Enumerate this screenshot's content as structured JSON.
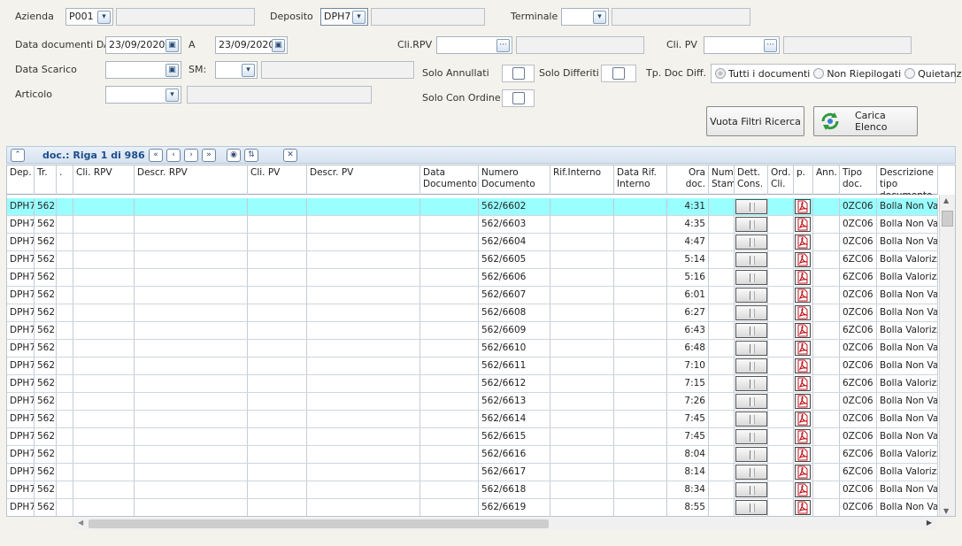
{
  "filters": {
    "azienda_label": "Azienda",
    "azienda_value": "P001",
    "deposito_label": "Deposito",
    "deposito_value": "DPH7",
    "terminale_label": "Terminale",
    "terminale_value": "",
    "data_doc_da_label": "Data documenti DA",
    "data_doc_da_value": "23/09/2020",
    "a_label": "A",
    "a_value": "23/09/2020",
    "cli_rpv_label": "Cli.RPV",
    "cli_pv_label": "Cli. PV",
    "data_scarico_label": "Data Scarico",
    "sm_label": "SM:",
    "solo_annullati_label": "Solo Annullati",
    "solo_differiti_label": "Solo Differiti",
    "tp_doc_diff_label": "Tp. Doc Diff.",
    "radio_options": [
      "Tutti i documenti",
      "Non Riepilogati",
      "Quietanze"
    ],
    "articolo_label": "Articolo",
    "solo_con_ordine_label": "Solo Con Ordine"
  },
  "buttons": {
    "vuota_filtri": "Vuota Filtri Ricerca",
    "carica_elenco": "Carica Elenco"
  },
  "grid": {
    "title": "doc.: Riga 1 di 986",
    "headers": {
      "dep": "Dep.",
      "tr": "Tr.",
      "dot": ".",
      "cli_rpv": "Cli. RPV",
      "descr_rpv": "Descr. RPV",
      "cli_pv": "Cli. PV",
      "descr_pv": "Descr. PV",
      "data_doc": "Data Documento",
      "num_doc": "Numero Documento",
      "rif_interno": "Rif.Interno",
      "data_rif": "Data Rif. Interno",
      "ora_doc": "Ora doc.",
      "num_stam": "Num Stam",
      "dett_cons": "Dett. Cons.",
      "ord_cli": "Ord. Cli.",
      "p": "p.",
      "ann": "Ann.",
      "tipo_doc": "Tipo doc.",
      "descr_tipo": "Descrizione tipo documento"
    },
    "rows": [
      {
        "dep": "DPH7",
        "tr": "562",
        "num": "562/6602",
        "ora": "4:31",
        "tipo": "0ZC06",
        "descr": "Bolla Non Valorizzata"
      },
      {
        "dep": "DPH7",
        "tr": "562",
        "num": "562/6603",
        "ora": "4:35",
        "tipo": "0ZC06",
        "descr": "Bolla Non Valorizzata"
      },
      {
        "dep": "DPH7",
        "tr": "562",
        "num": "562/6604",
        "ora": "4:47",
        "tipo": "0ZC06",
        "descr": "Bolla Non Valorizzata"
      },
      {
        "dep": "DPH7",
        "tr": "562",
        "num": "562/6605",
        "ora": "5:14",
        "tipo": "6ZC06",
        "descr": "Bolla Valorizzata"
      },
      {
        "dep": "DPH7",
        "tr": "562",
        "num": "562/6606",
        "ora": "5:16",
        "tipo": "6ZC06",
        "descr": "Bolla Valorizzata"
      },
      {
        "dep": "DPH7",
        "tr": "562",
        "num": "562/6607",
        "ora": "6:01",
        "tipo": "0ZC06",
        "descr": "Bolla Non Valorizzata"
      },
      {
        "dep": "DPH7",
        "tr": "562",
        "num": "562/6608",
        "ora": "6:27",
        "tipo": "0ZC06",
        "descr": "Bolla Non Valorizzata"
      },
      {
        "dep": "DPH7",
        "tr": "562",
        "num": "562/6609",
        "ora": "6:43",
        "tipo": "6ZC06",
        "descr": "Bolla Valorizzata"
      },
      {
        "dep": "DPH7",
        "tr": "562",
        "num": "562/6610",
        "ora": "6:48",
        "tipo": "0ZC06",
        "descr": "Bolla Non Valorizzata"
      },
      {
        "dep": "DPH7",
        "tr": "562",
        "num": "562/6611",
        "ora": "7:10",
        "tipo": "0ZC06",
        "descr": "Bolla Non Valorizzata"
      },
      {
        "dep": "DPH7",
        "tr": "562",
        "num": "562/6612",
        "ora": "7:15",
        "tipo": "6ZC06",
        "descr": "Bolla Valorizzata"
      },
      {
        "dep": "DPH7",
        "tr": "562",
        "num": "562/6613",
        "ora": "7:26",
        "tipo": "0ZC06",
        "descr": "Bolla Non Valorizzata"
      },
      {
        "dep": "DPH7",
        "tr": "562",
        "num": "562/6614",
        "ora": "7:45",
        "tipo": "0ZC06",
        "descr": "Bolla Non Valorizzata"
      },
      {
        "dep": "DPH7",
        "tr": "562",
        "num": "562/6615",
        "ora": "7:45",
        "tipo": "0ZC06",
        "descr": "Bolla Non Valorizzata"
      },
      {
        "dep": "DPH7",
        "tr": "562",
        "num": "562/6616",
        "ora": "8:04",
        "tipo": "6ZC06",
        "descr": "Bolla Valorizzata"
      },
      {
        "dep": "DPH7",
        "tr": "562",
        "num": "562/6617",
        "ora": "8:14",
        "tipo": "6ZC06",
        "descr": "Bolla Valorizzata"
      },
      {
        "dep": "DPH7",
        "tr": "562",
        "num": "562/6618",
        "ora": "8:34",
        "tipo": "0ZC06",
        "descr": "Bolla Non Valorizzata"
      },
      {
        "dep": "DPH7",
        "tr": "562",
        "num": "562/6619",
        "ora": "8:55",
        "tipo": "0ZC06",
        "descr": "Bolla Non Valorizzata"
      }
    ]
  },
  "colors": {
    "selected_row": "#99ffff",
    "toolbar_title": "#1f4d8c",
    "pdf_icon": "#c0141c"
  },
  "icons": {
    "dropdown": "chevron-down-icon",
    "calendar": "calendar-icon",
    "lookup": "ellipsis-icon",
    "refresh": "refresh-icon",
    "pdf": "pdf-icon",
    "detail": "detail-icon"
  }
}
